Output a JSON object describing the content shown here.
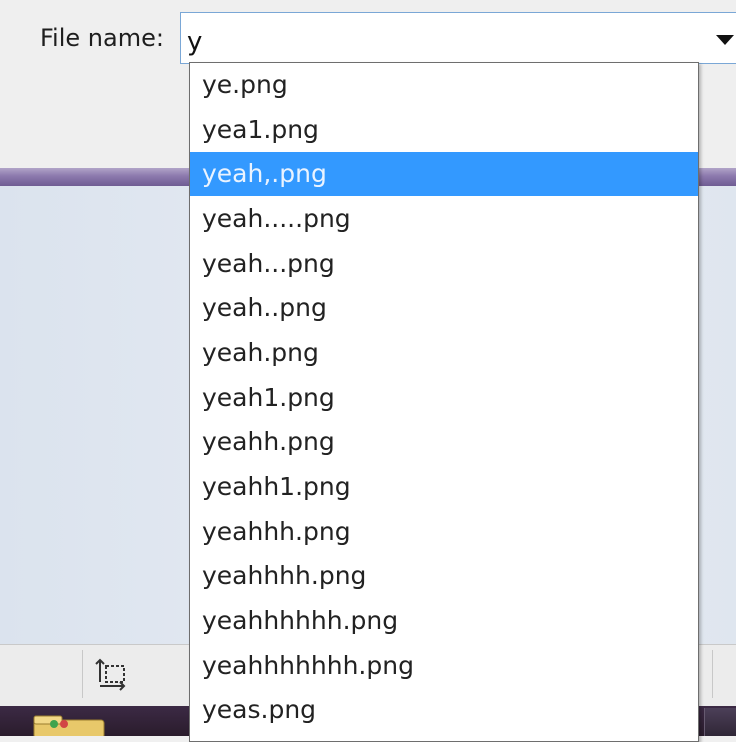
{
  "filename": {
    "label": "File name:",
    "value": "y"
  },
  "autocomplete": {
    "items": [
      "ye.png",
      "yea1.png",
      "yeah,.png",
      "yeah.....png",
      "yeah...png",
      "yeah..png",
      "yeah.png",
      "yeah1.png",
      "yeahh.png",
      "yeahh1.png",
      "yeahhh.png",
      "yeahhhh.png",
      "yeahhhhhh.png",
      "yeahhhhhhh.png",
      "yeas.png"
    ],
    "selected": "yeah,.png"
  },
  "colors": {
    "selection": "#3399ff",
    "divider": "#8c79ad",
    "input_border": "#7aa7d6"
  },
  "icons": [
    "dropdown-arrow-icon",
    "select-region-icon",
    "folder-icon",
    "taskbar-button-icon"
  ]
}
